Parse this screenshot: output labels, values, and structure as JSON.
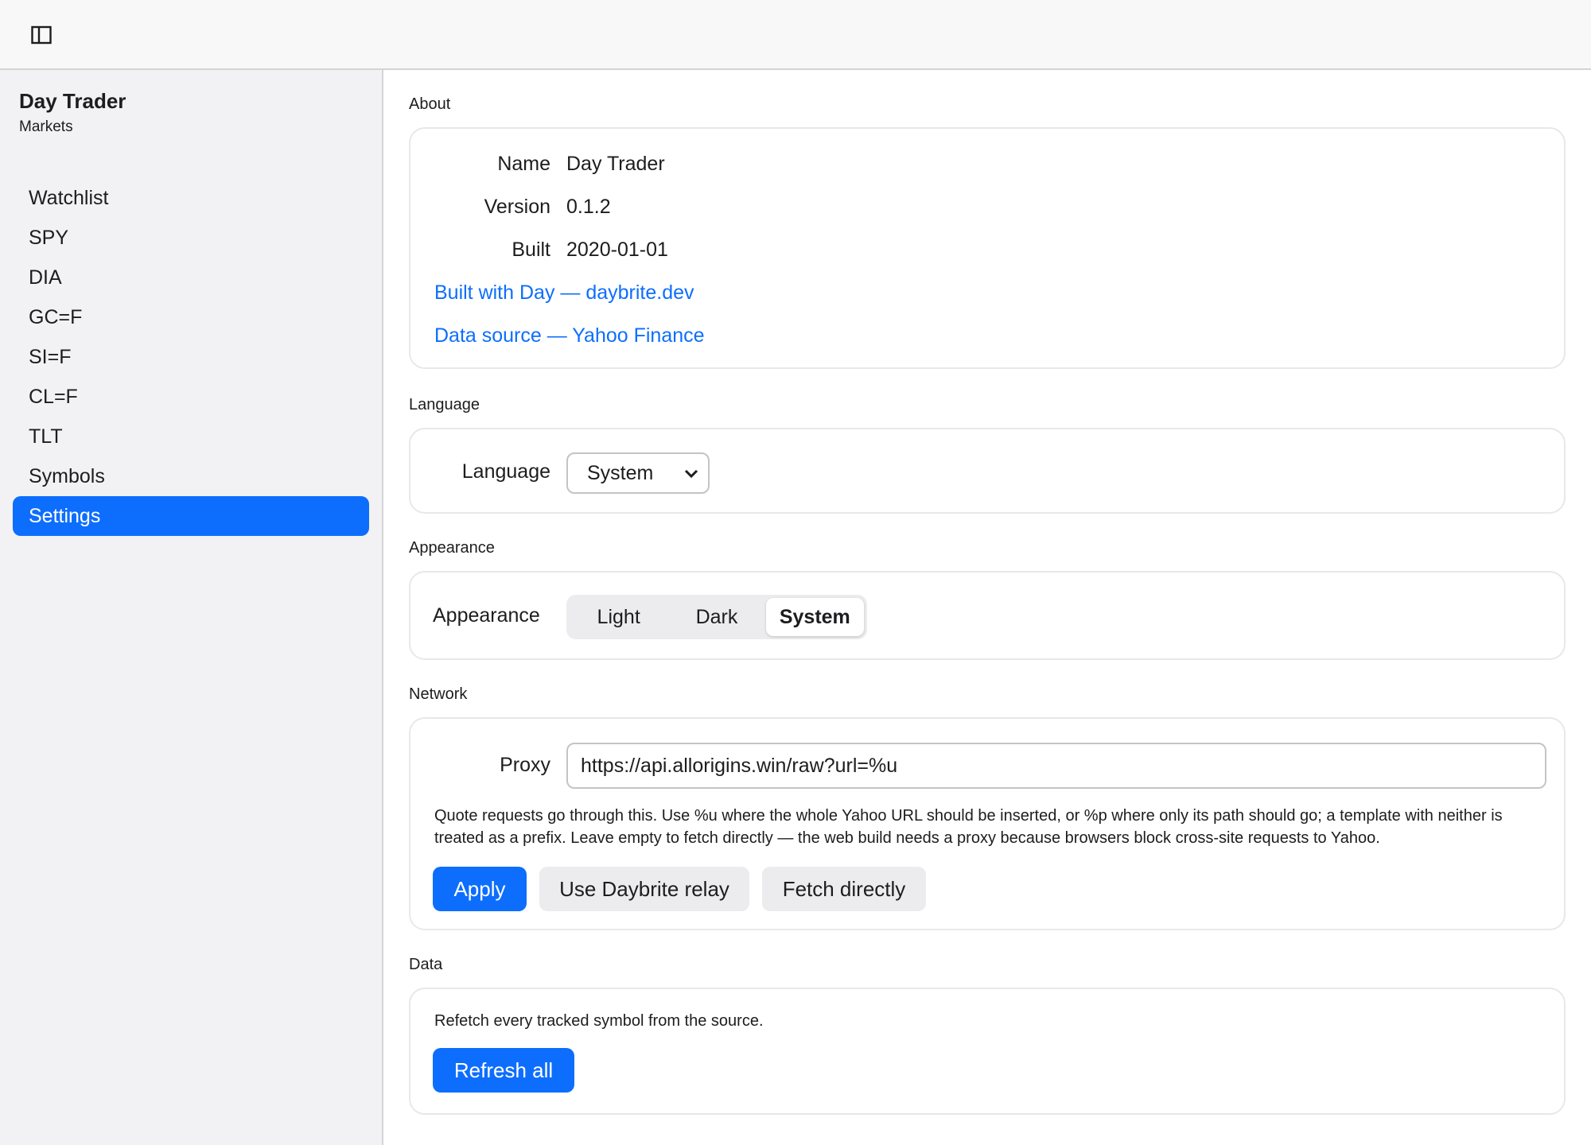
{
  "topbar": {
    "toggle_icon": "sidebar-toggle-icon"
  },
  "sidebar": {
    "title": "Day Trader",
    "subtitle": "Markets",
    "items": [
      {
        "label": "Watchlist"
      },
      {
        "label": "SPY"
      },
      {
        "label": "DIA"
      },
      {
        "label": "GC=F"
      },
      {
        "label": "SI=F"
      },
      {
        "label": "CL=F"
      },
      {
        "label": "TLT"
      },
      {
        "label": "Symbols"
      },
      {
        "label": "Settings",
        "active": true
      }
    ]
  },
  "about": {
    "section_title": "About",
    "name_label": "Name",
    "name_value": "Day Trader",
    "version_label": "Version",
    "version_value": "0.1.2",
    "built_label": "Built",
    "built_value": "2020-01-01",
    "link_built_with": "Built with Day — daybrite.dev",
    "link_data_source": "Data source — Yahoo Finance"
  },
  "language": {
    "section_title": "Language",
    "label": "Language",
    "selected": "System"
  },
  "appearance": {
    "section_title": "Appearance",
    "label": "Appearance",
    "options": [
      "Light",
      "Dark",
      "System"
    ],
    "selected": "System"
  },
  "network": {
    "section_title": "Network",
    "proxy_label": "Proxy",
    "proxy_value": "https://api.allorigins.win/raw?url=%u",
    "help": "Quote requests go through this. Use %u where the whole Yahoo URL should be inserted, or %p where only its path should go; a template with neither is treated as a prefix. Leave empty to fetch directly — the web build needs a proxy because browsers block cross-site requests to Yahoo.",
    "apply_label": "Apply",
    "relay_label": "Use Daybrite relay",
    "direct_label": "Fetch directly"
  },
  "data_section": {
    "section_title": "Data",
    "description": "Refetch every tracked symbol from the source.",
    "refresh_label": "Refresh all"
  },
  "colors": {
    "accent": "#0d6efd",
    "sidebar_bg": "#f2f2f4",
    "topbar_bg": "#f8f8f8"
  }
}
